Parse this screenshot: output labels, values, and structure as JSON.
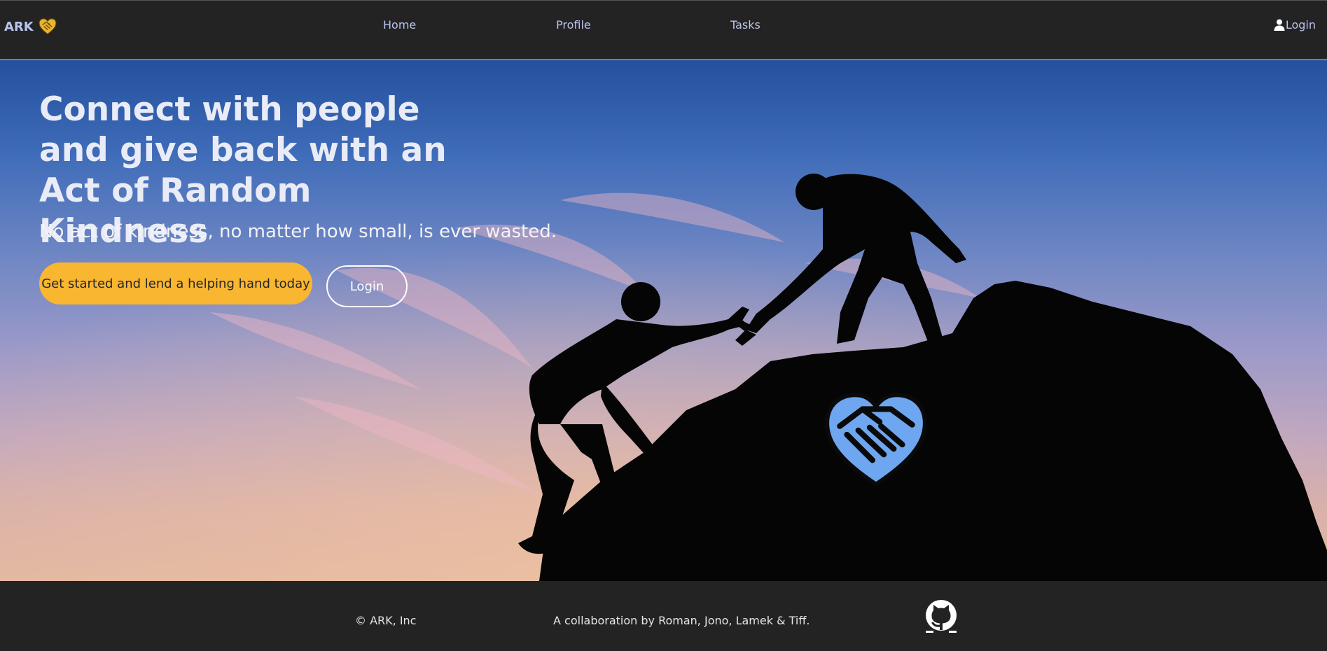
{
  "navbar": {
    "brand": "ARK",
    "links": [
      "Home",
      "Profile",
      "Tasks"
    ],
    "login": "Login"
  },
  "hero": {
    "title": "Connect with people and give back with an Act of Random Kindness",
    "subtitle": "No act of kindness, no matter how small, is ever wasted.",
    "cta_label": "Get started and lend a helping hand today",
    "login_label": "Login"
  },
  "footer": {
    "copyright": "© ARK, Inc",
    "credits": "A collaboration by Roman, Jono, Lamek & Tiff."
  },
  "icons": {
    "brand_logo": "heart-handshake-icon",
    "login": "user-icon",
    "hero_logo": "heart-handshake-icon",
    "footer_link": "github-icon"
  },
  "colors": {
    "navbar_bg": "#232323",
    "nav_text": "#b9c4ef",
    "cta": "#f9b631",
    "heart": "#6ea6f0",
    "brand_heart": "#e9b52d"
  }
}
